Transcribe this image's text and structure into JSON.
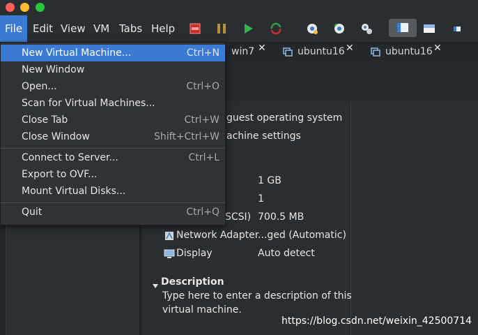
{
  "colors": {
    "close": "#ff5f57",
    "minimize": "#febc2e",
    "zoom": "#28c840",
    "accent": "#3b7bd6"
  },
  "menubar": {
    "items": [
      {
        "label": "File"
      },
      {
        "label": "Edit"
      },
      {
        "label": "View"
      },
      {
        "label": "VM"
      },
      {
        "label": "Tabs"
      },
      {
        "label": "Help"
      }
    ]
  },
  "toolbar": {
    "icons": [
      "stop-icon",
      "pause-icon",
      "play-icon",
      "restart-icon",
      "snapshot-icon",
      "snapshot-restore-icon",
      "snapshot-manager-icon",
      "view-console-icon",
      "view-fullscreen-icon",
      "view-unity-icon"
    ]
  },
  "tabs": [
    {
      "label": "win7"
    },
    {
      "label": "ubuntu16"
    },
    {
      "label": "ubuntu16"
    }
  ],
  "file_menu": {
    "groups": [
      [
        {
          "label": "New Virtual Machine...",
          "shortcut": "Ctrl+N",
          "highlighted": true
        },
        {
          "label": "New Window",
          "shortcut": ""
        },
        {
          "label": "Open...",
          "shortcut": "Ctrl+O"
        },
        {
          "label": "Scan for Virtual Machines...",
          "shortcut": ""
        },
        {
          "label": "Close Tab",
          "shortcut": "Ctrl+W"
        },
        {
          "label": "Close Window",
          "shortcut": "Shift+Ctrl+W"
        }
      ],
      [
        {
          "label": "Connect to Server...",
          "shortcut": "Ctrl+L"
        },
        {
          "label": "Export to OVF...",
          "shortcut": ""
        },
        {
          "label": "Mount Virtual Disks...",
          "shortcut": ""
        }
      ],
      [
        {
          "label": "Quit",
          "shortcut": "Ctrl+Q"
        }
      ]
    ]
  },
  "vm_actions": {
    "power_on": "guest operating system",
    "edit_settings": "achine settings"
  },
  "devices": [
    {
      "name": "",
      "value": "1 GB"
    },
    {
      "name": "",
      "value": "1"
    },
    {
      "name": "SCSI)",
      "value": "700.5 MB"
    },
    {
      "name": "Network Adapter",
      "value": "...ged (Automatic)",
      "icon": "network-adapter-icon"
    },
    {
      "name": "Display",
      "value": "Auto detect",
      "icon": "display-icon"
    }
  ],
  "description": {
    "heading": "Description",
    "text_line1": "Type here to enter a description of this",
    "text_line2": "virtual machine."
  },
  "watermark": "https://blog.csdn.net/weixin_42500714"
}
